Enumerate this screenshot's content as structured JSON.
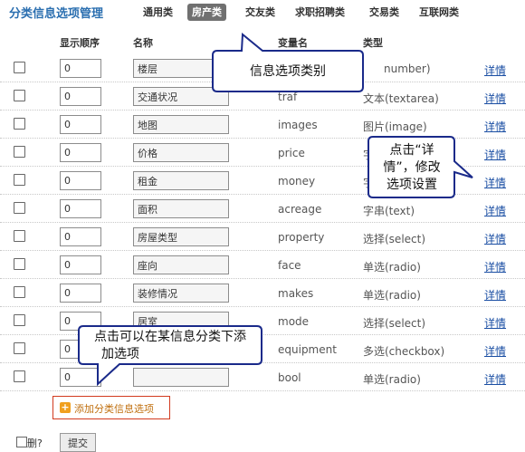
{
  "header": {
    "title": "分类信息选项管理",
    "tabs": [
      {
        "label": "通用类",
        "active": false
      },
      {
        "label": "房产类",
        "active": true
      },
      {
        "label": "交友类",
        "active": false
      },
      {
        "label": "求职招聘类",
        "active": false
      },
      {
        "label": "交易类",
        "active": false
      },
      {
        "label": "互联网类",
        "active": false
      }
    ]
  },
  "columns": {
    "order": "显示顺序",
    "name": "名称",
    "var": "变量名",
    "type": "类型"
  },
  "rows": [
    {
      "order": "0",
      "name": "楼层",
      "var": "",
      "type": "number)",
      "detail": "详情"
    },
    {
      "order": "0",
      "name": "交通状况",
      "var": "traf",
      "type": "文本(textarea)",
      "detail": "详情"
    },
    {
      "order": "0",
      "name": "地图",
      "var": "images",
      "type": "图片(image)",
      "detail": "详情"
    },
    {
      "order": "0",
      "name": "价格",
      "var": "price",
      "type": "字",
      "detail": "详情"
    },
    {
      "order": "0",
      "name": "租金",
      "var": "money",
      "type": "字",
      "detail": "详情"
    },
    {
      "order": "0",
      "name": "面积",
      "var": "acreage",
      "type": "字串(text)",
      "detail": "详情"
    },
    {
      "order": "0",
      "name": "房屋类型",
      "var": "property",
      "type": "选择(select)",
      "detail": "详情"
    },
    {
      "order": "0",
      "name": "座向",
      "var": "face",
      "type": "单选(radio)",
      "detail": "详情"
    },
    {
      "order": "0",
      "name": "装修情况",
      "var": "makes",
      "type": "单选(radio)",
      "detail": "详情"
    },
    {
      "order": "0",
      "name": "居室",
      "var": "mode",
      "type": "选择(select)",
      "detail": "详情"
    },
    {
      "order": "0",
      "name": "",
      "var": "equipment",
      "type": "多选(checkbox)",
      "detail": "详情"
    },
    {
      "order": "0",
      "name": "",
      "var": "bool",
      "type": "单选(radio)",
      "detail": "详情"
    }
  ],
  "add_option": "添加分类信息选项",
  "footer": {
    "delete_label": "删?",
    "submit_label": "提交"
  },
  "callouts": {
    "category": "信息选项类别",
    "detail_line1": "点击“详",
    "detail_line2": "情”，修改",
    "detail_line3": "选项设置",
    "add_line1": "点击可以在某信息分类下添",
    "add_line2": "加选项"
  },
  "colors": {
    "title": "#2b6fb0",
    "link": "#1a4ea3",
    "callout_fill": "#ffffff",
    "callout_border": "#1a2a8a",
    "add_border": "#d23a1f"
  }
}
